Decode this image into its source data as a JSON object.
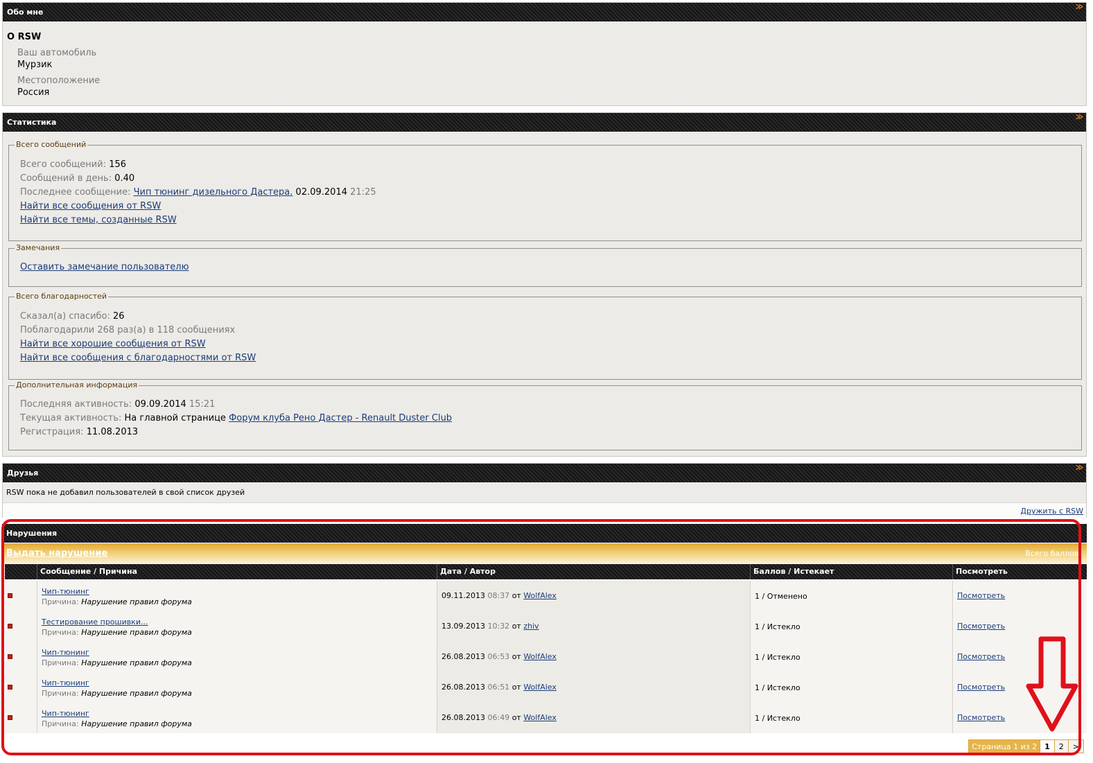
{
  "about": {
    "header": "Обо мне",
    "title": "О RSW",
    "fields": [
      {
        "label": "Ваш автомобиль",
        "value": "Мурзик"
      },
      {
        "label": "Местоположение",
        "value": "Россия"
      }
    ]
  },
  "stats": {
    "header": "Статистика",
    "posts": {
      "legend": "Всего сообщений",
      "total_label": "Всего сообщений:",
      "total_value": "156",
      "perday_label": "Сообщений в день:",
      "perday_value": "0.40",
      "last_label": "Последнее сообщение:",
      "last_link": "Чип тюнинг дизельного Дастера.",
      "last_date": "02.09.2014",
      "last_time": "21:25",
      "find_posts": "Найти все сообщения от RSW",
      "find_threads": "Найти все темы, созданные RSW"
    },
    "notes": {
      "legend": "Замечания",
      "leave": "Оставить замечание пользователю"
    },
    "thanks": {
      "legend": "Всего благодарностей",
      "said_label": "Сказал(а) спасибо:",
      "said_value": "26",
      "thanked": "Поблагодарили 268 раз(а) в 118 сообщениях",
      "find_good": "Найти все хорошие сообщения от RSW",
      "find_thanked": "Найти все сообщения с благодарностями от RSW"
    },
    "extra": {
      "legend": "Дополнительная информация",
      "last_act_label": "Последняя активность:",
      "last_act_date": "09.09.2014",
      "last_act_time": "15:21",
      "cur_act_label": "Текущая активность:",
      "cur_act_text": "На главной странице",
      "cur_act_link": "Форум клуба Рено Дастер - Renault Duster Club",
      "reg_label": "Регистрация:",
      "reg_value": "11.08.2013"
    }
  },
  "friends": {
    "header": "Друзья",
    "text": "RSW пока не добавил пользователей в свой список друзей",
    "befriend": "Дружить с RSW"
  },
  "violations": {
    "header": "Нарушения",
    "issue": "Выдать нарушение",
    "total_points": "Всего баллов:",
    "columns": [
      "Сообщение / Причина",
      "Дата / Автор",
      "Баллов / Истекает",
      "Посмотреть"
    ],
    "reason_label": "Причина:",
    "from": "от",
    "rows": [
      {
        "title": "Чип-тюнинг",
        "reason": "Нарушение правил форума",
        "date": "09.11.2013",
        "time": "08:37",
        "author": "WolfAlex",
        "points": "1 / Отменено",
        "view": "Посмотреть"
      },
      {
        "title": "Тестирование прошивки...",
        "reason": "Нарушение правил форума",
        "date": "13.09.2013",
        "time": "10:32",
        "author": "zhiv",
        "points": "1 / Истекло",
        "view": "Посмотреть"
      },
      {
        "title": "Чип-тюнинг",
        "reason": "Нарушение правил форума",
        "date": "26.08.2013",
        "time": "06:53",
        "author": "WolfAlex",
        "points": "1 / Истекло",
        "view": "Посмотреть"
      },
      {
        "title": "Чип-тюнинг",
        "reason": "Нарушение правил форума",
        "date": "26.08.2013",
        "time": "06:51",
        "author": "WolfAlex",
        "points": "1 / Истекло",
        "view": "Посмотреть"
      },
      {
        "title": "Чип-тюнинг",
        "reason": "Нарушение правил форума",
        "date": "26.08.2013",
        "time": "06:49",
        "author": "WolfAlex",
        "points": "1 / Истекло",
        "view": "Посмотреть"
      }
    ],
    "pager": {
      "label": "Страница 1 из 2",
      "current": "1",
      "next_page": "2",
      "next": ">"
    }
  },
  "annotation_color": "#e0101a"
}
